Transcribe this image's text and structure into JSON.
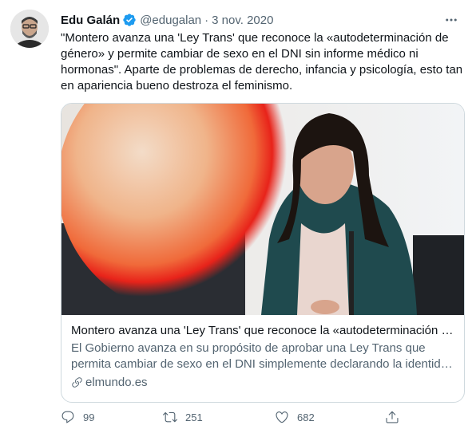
{
  "tweet": {
    "author_name": "Edu Galán",
    "handle": "@edugalan",
    "separator": "·",
    "date": "3 nov. 2020",
    "text": "\"Montero avanza una 'Ley Trans' que reconoce la «autodeterminación de género» y permite cambiar de sexo en el DNI sin informe médico ni hormonas\". Aparte de problemas de derecho, infancia y psicología, esto tan en apariencia bueno destroza el feminismo."
  },
  "card": {
    "title": "Montero avanza una 'Ley Trans' que reconoce la «autodeterminación d…",
    "description_line1": "El Gobierno avanza en su propósito de aprobar una Ley Trans que",
    "description_line2": "permita cambiar de sexo en el DNI simplemente declarando la identid…",
    "domain": "elmundo.es"
  },
  "actions": {
    "replies": "99",
    "retweets": "251",
    "likes": "682"
  },
  "icons": {
    "verified": "verified-badge-icon",
    "more": "more-options-icon",
    "reply": "reply-icon",
    "retweet": "retweet-icon",
    "like": "heart-icon",
    "share": "share-icon",
    "link": "link-icon"
  },
  "colors": {
    "verified_blue": "#1d9bf0",
    "secondary_text": "#536471",
    "primary_text": "#0f1419",
    "border": "#cfd9de"
  }
}
